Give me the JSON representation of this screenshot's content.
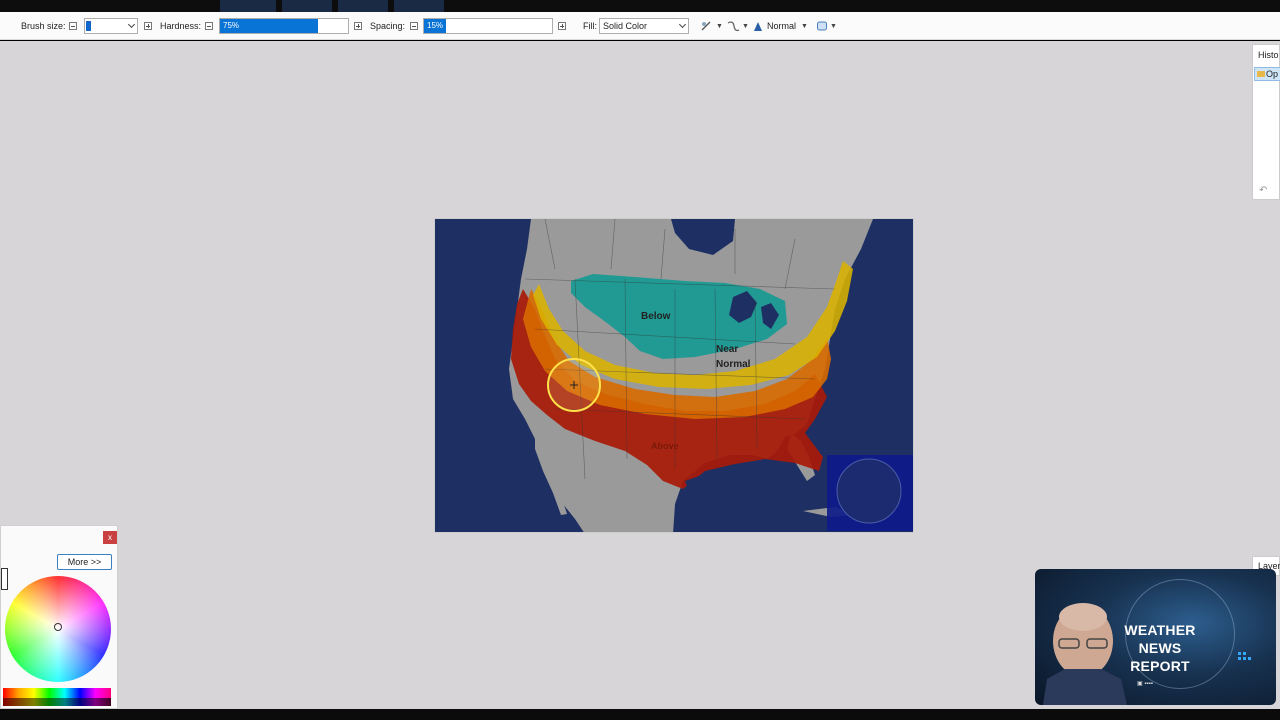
{
  "toolbar": {
    "brush_size_label": "Brush size:",
    "brush_size_value": "",
    "hardness_label": "Hardness:",
    "hardness_value": "75%",
    "hardness_fraction": 0.75,
    "spacing_label": "Spacing:",
    "spacing_value": "15%",
    "spacing_fraction": 0.15,
    "fill_label": "Fill:",
    "fill_value": "Solid Color",
    "blend_mode_value": "Normal",
    "icons": [
      "minus-icon",
      "plus-icon",
      "antialias-icon",
      "alpha-blend-icon",
      "blend-mode-icon",
      "shape-icon"
    ]
  },
  "map": {
    "label_below": "Below",
    "label_near_normal_1": "Near",
    "label_near_normal_2": "Normal",
    "label_above": "Above",
    "colors": {
      "ocean": "#1e3063",
      "land": "#9a9a9a",
      "below": "#149a94",
      "yellow": "#d9b300",
      "orange": "#d86a00",
      "red": "#a81a08",
      "cursor": "#ffe24a"
    }
  },
  "history_panel": {
    "title": "Histo",
    "item": "Op"
  },
  "layers_panel": {
    "title": "Layer"
  },
  "color_panel": {
    "close_label": "x",
    "more_label": "More >>"
  },
  "webcam": {
    "title_line1": "WEATHER NEWS",
    "title_line2": "REPORT"
  }
}
